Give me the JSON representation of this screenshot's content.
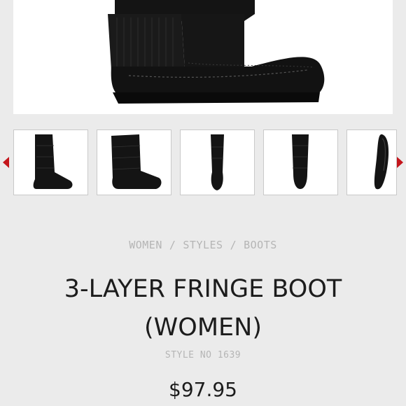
{
  "gallery": {
    "main_image_icon": "boot-side-view-icon",
    "prev_icon": "carousel-prev-arrow-icon",
    "next_icon": "carousel-next-arrow-icon",
    "thumbnails": [
      {
        "icon": "boot-side-view-icon"
      },
      {
        "icon": "boot-angled-view-icon"
      },
      {
        "icon": "boot-front-view-icon"
      },
      {
        "icon": "boot-back-view-icon"
      },
      {
        "icon": "boot-sole-view-icon"
      }
    ]
  },
  "breadcrumb": {
    "items": [
      "WOMEN",
      "STYLES",
      "BOOTS"
    ],
    "separator": "/"
  },
  "product": {
    "title_line1": "3-LAYER FRINGE BOOT",
    "title_line2": "(WOMEN)",
    "style_no": "STYLE NO 1639",
    "price": "$97.95"
  },
  "colors": {
    "background": "#ebebeb",
    "accent_arrow": "#c4161c",
    "muted_text": "#b5b5b5",
    "title_text": "#1c1c1c",
    "boot": "#141414"
  }
}
